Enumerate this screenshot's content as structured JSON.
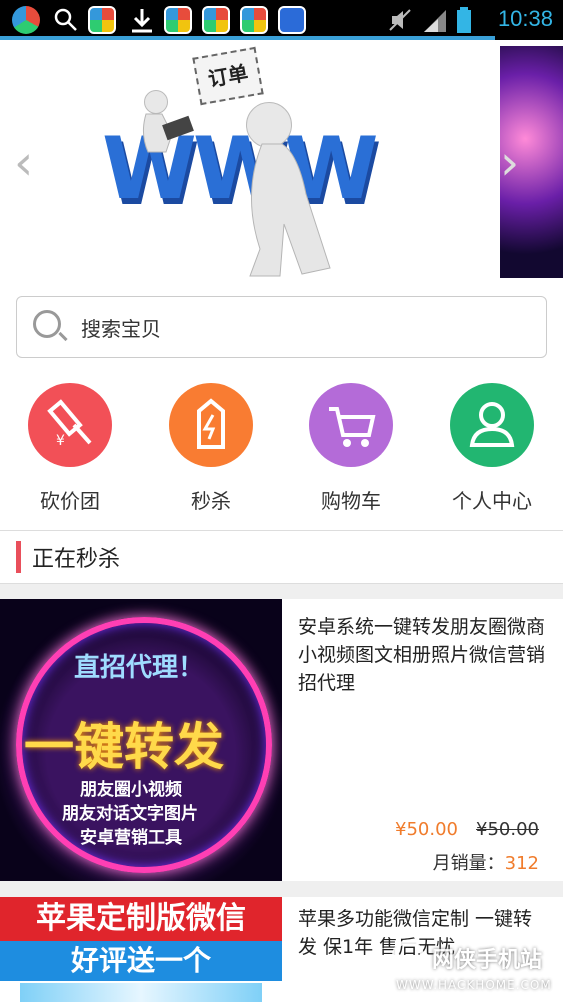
{
  "status_bar": {
    "time": "10:38",
    "icons": [
      "sync-icon",
      "search-icon",
      "app-icon",
      "download-icon",
      "app-icon",
      "app-icon",
      "app-icon",
      "baidu-icon",
      "mute-icon",
      "signal-icon",
      "battery-icon"
    ]
  },
  "banner": {
    "sign_text": "订单",
    "logo_text": "WWW"
  },
  "search": {
    "placeholder": "搜索宝贝"
  },
  "nav": [
    {
      "label": "砍价团",
      "color": "#f25057",
      "icon": "hammer-icon"
    },
    {
      "label": "秒杀",
      "color": "#f97c32",
      "icon": "flash-tag-icon"
    },
    {
      "label": "购物车",
      "color": "#b46bd8",
      "icon": "cart-icon"
    },
    {
      "label": "个人中心",
      "color": "#22b671",
      "icon": "user-icon"
    }
  ],
  "section": {
    "title": "正在秒杀"
  },
  "products": [
    {
      "title": "安卓系统一键转发朋友圈微商小视频图文相册照片微信营销 招代理",
      "price": "¥50.00",
      "old_price": "¥50.00",
      "sales_label": "月销量：",
      "sales": "312",
      "thumb_lines": [
        "直招代理！",
        "一键转发",
        "朋友圈小视频",
        "朋友对话文字图片",
        "安卓营销工具"
      ]
    },
    {
      "title": "苹果多功能微信定制 一键转发 保1年 售后无忧",
      "thumb_lines": [
        "苹果定制版微信",
        "好评送一个"
      ]
    }
  ],
  "watermark": {
    "name": "网侠手机站",
    "url": "WWW.HACKHOME.COM"
  },
  "colors": {
    "accent": "#e94f5b",
    "price": "#f07c2c",
    "status_time": "#33b5e5"
  }
}
